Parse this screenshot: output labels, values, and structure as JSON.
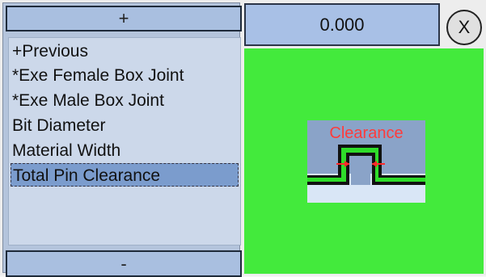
{
  "menu": {
    "up_label": "+",
    "down_label": "-",
    "items": [
      {
        "label": "+Previous"
      },
      {
        "label": "*Exe Female Box Joint"
      },
      {
        "label": "*Exe Male Box Joint"
      },
      {
        "label": " Bit Diameter"
      },
      {
        "label": " Material Width"
      },
      {
        "label": " Total Pin Clearance",
        "selected": true
      }
    ]
  },
  "value_display": {
    "value": "0.000"
  },
  "close_button": {
    "label": "X"
  },
  "diagram": {
    "title": "Clearance",
    "colors": {
      "background": "#43ea3c",
      "label": "#ff3b3b",
      "arrow": "#ff2a2a",
      "pin": "#2fdc2a",
      "panel": "#8aa3c8"
    },
    "icons": [
      "arrow-right-icon",
      "arrow-left-icon"
    ]
  }
}
